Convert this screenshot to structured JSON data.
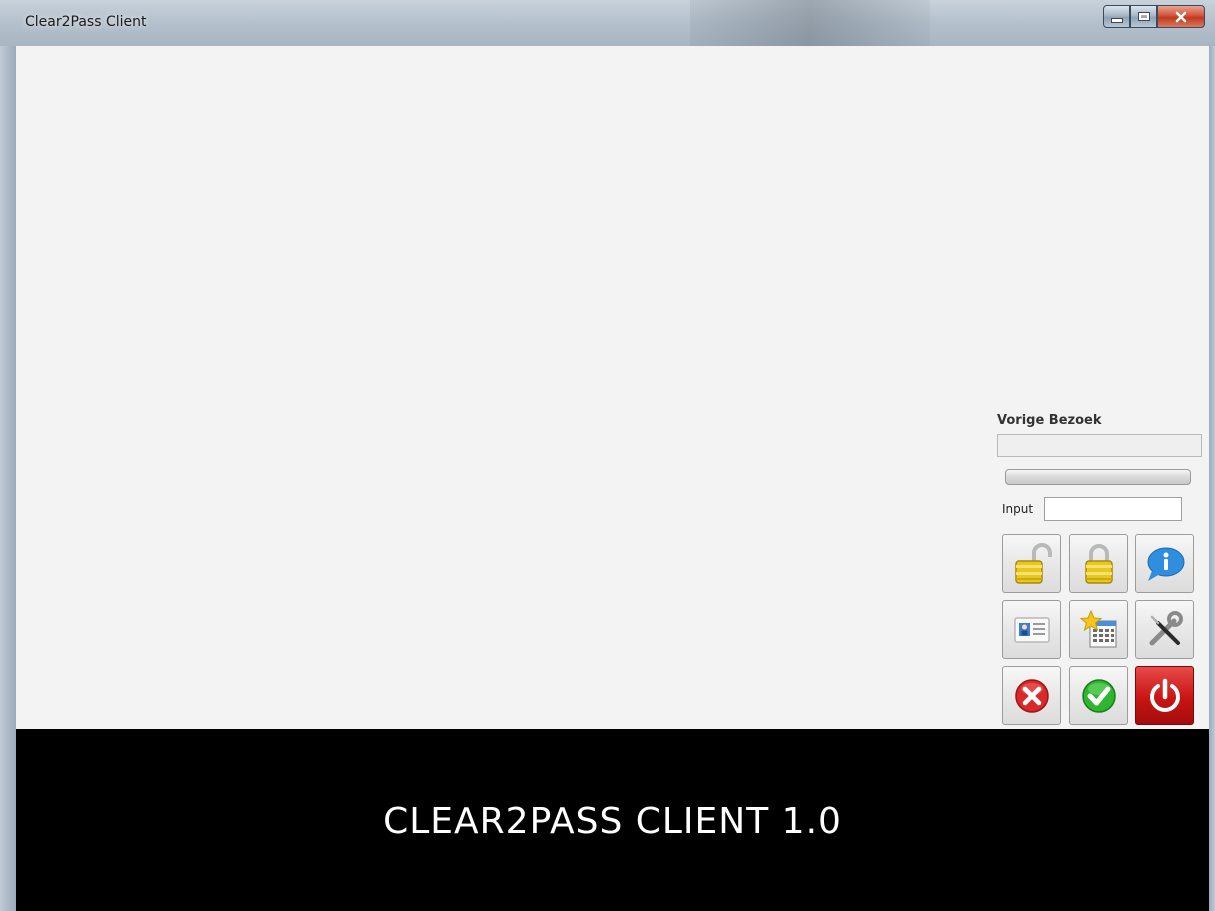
{
  "window": {
    "title": "Clear2Pass Client"
  },
  "panel": {
    "previous_visit_label": "Vorige Bezoek",
    "previous_visit_value": "",
    "progress": 0,
    "input_label": "Input",
    "input_value": ""
  },
  "buttons": [
    {
      "name": "unlock-button",
      "icon": "open-padlock-icon"
    },
    {
      "name": "lock-button",
      "icon": "closed-padlock-icon"
    },
    {
      "name": "info-button",
      "icon": "info-speech-bubble-icon"
    },
    {
      "name": "id-card-button",
      "icon": "id-card-icon"
    },
    {
      "name": "favorites-button",
      "icon": "star-calendar-icon"
    },
    {
      "name": "settings-button",
      "icon": "wrench-screwdriver-icon"
    },
    {
      "name": "cancel-button",
      "icon": "red-x-circle-icon"
    },
    {
      "name": "confirm-button",
      "icon": "green-check-circle-icon"
    },
    {
      "name": "power-button",
      "icon": "power-icon"
    }
  ],
  "colors": {
    "content_bg": "#f3f3f3",
    "footer_bg": "#000000",
    "footer_text": "#ffffff",
    "close_button": "#c0391f"
  },
  "footer": {
    "text": "CLEAR2PASS CLIENT 1.0"
  }
}
